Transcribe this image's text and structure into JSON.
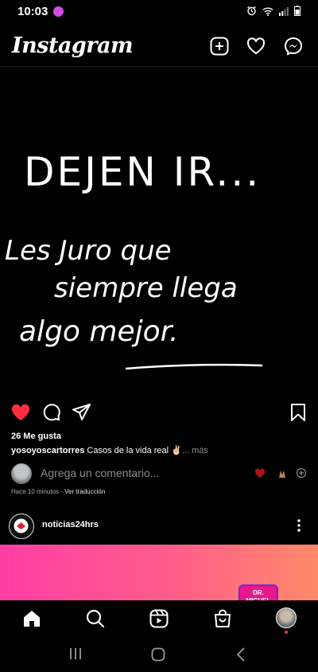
{
  "status_bar": {
    "time": "10:03"
  },
  "header": {
    "logo": "Instagram"
  },
  "post": {
    "image_text": {
      "line1": "DEJEN IR...",
      "line2": "Les Juro que",
      "line3": "siempre llega",
      "line4": "algo mejor."
    },
    "likes": "26 Me gusta",
    "caption_user": "yosoyoscartorres",
    "caption_text": "Casos de la vida real ✌🏻",
    "caption_more": "... más",
    "comment_placeholder": "Agrega un comentario...",
    "time_ago": "Hace 10 minutos",
    "translate": "Ver traducción"
  },
  "post2": {
    "username": "noticias24hrs",
    "badge_text": "DR. MIGUEL"
  },
  "colors": {
    "like": "#ff3040",
    "background": "#000000",
    "muted": "#8e8e8e"
  }
}
